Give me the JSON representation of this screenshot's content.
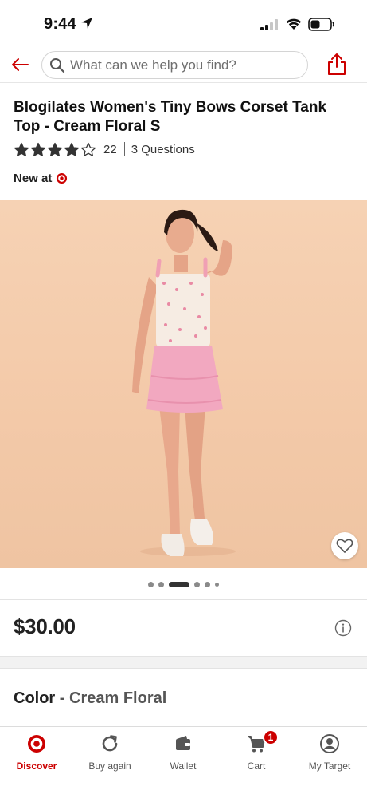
{
  "status_bar": {
    "time": "9:44"
  },
  "search": {
    "placeholder": "What can we help you find?"
  },
  "product": {
    "title": "Blogilates Women's Tiny Bows Corset Tank Top - Cream Floral S",
    "rating": 4,
    "rating_max": 5,
    "review_count": "22",
    "questions": "3 Questions",
    "new_at": "New at",
    "price": "$30.00",
    "color_label": "Color",
    "color_separator": "-",
    "color_value": "Cream Floral"
  },
  "carousel": {
    "total": 6,
    "active_index": 2
  },
  "nav": {
    "items": [
      {
        "label": "Discover",
        "icon": "target-bullseye-icon",
        "active": true
      },
      {
        "label": "Buy again",
        "icon": "refresh-icon",
        "active": false
      },
      {
        "label": "Wallet",
        "icon": "wallet-icon",
        "active": false
      },
      {
        "label": "Cart",
        "icon": "cart-icon",
        "active": false,
        "badge": "1"
      },
      {
        "label": "My Target",
        "icon": "user-icon",
        "active": false
      }
    ]
  },
  "colors": {
    "brand_red": "#cc0000",
    "text": "#222222",
    "muted": "#555555"
  }
}
